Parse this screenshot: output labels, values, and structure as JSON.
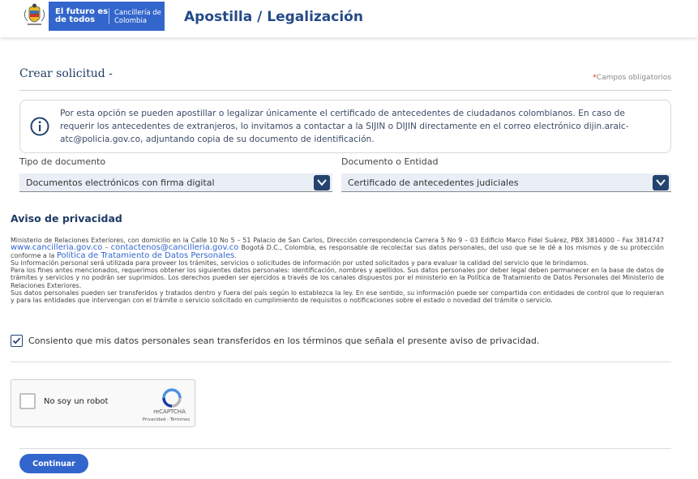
{
  "header": {
    "logo_line1": "El futuro es de todos",
    "logo_line2": "Cancillería de Colombia",
    "title": "Apostilla / Legalización"
  },
  "form": {
    "title": "Crear solicitud -",
    "required_star": "*",
    "required_note": "Campos obligatorios"
  },
  "info": {
    "text_before": "Por esta opción se pueden apostillar o legalizar únicamente el certificado de antecedentes de ciudadanos colombianos. En caso de requerir los antecedentes de extranjeros, lo invitamos a contactar a la SIJIN o DIJIN directamente en el correo electrónico ",
    "email": "dijin.araic-atc@policia.gov.co",
    "text_after": ", adjuntando copia de su documento de identificación."
  },
  "fields": {
    "tipo_label": "Tipo de documento",
    "tipo_value": "Documentos electrónicos con firma digital",
    "entidad_label": "Documento o Entidad",
    "entidad_value": "Certificado de antecedentes judiciales"
  },
  "privacy": {
    "title": "Aviso de privacidad",
    "p1_a": "Ministerio de Relaciones Exteriores, con domicilio en la Calle 10 No 5 – 51 Palacio de San Carlos, Dirección correspondencia Carrera 5 No 9 – 03 Edificio Marco Fidel Suárez, PBX 3814000 – Fax 3814747 ",
    "site_link": "www.cancilleria.gov.co",
    "p1_dash": " – ",
    "email_link": "contactenos@cancilleria.gov.co",
    "p1_b": " Bogotá D.C., Colombia, es responsable de recolectar sus datos personales, del uso que se le dé a los mismos y de su protección conforme a la ",
    "policy_link": "Política de Tratamiento de Datos Personales",
    "p1_end": ".",
    "p2": "Su información personal será utilizada para proveer los trámites, servicios o solicitudes de información por usted solicitados y para evaluar la calidad del servicio que le brindamos.",
    "p3": "Para los fines antes mencionados, requerimos obtener los siguientes datos personales: identificación, nombres y apellidos. Sus datos personales por deber legal deben permanecer en la base de datos de trámites y servicios y no podrán ser suprimidos. Los derechos pueden ser ejercidos a través de los canales dispuestos por el ministerio en la Política de Tratamiento de Datos Personales del Ministerio de Relaciones Exteriores.",
    "p4": "Sus datos personales pueden ser transferidos y tratados dentro y fuera del país según lo establezca la ley. En ese sentido, su información puede ser compartida con entidades de control que lo requieran y para las entidades que intervengan con el trámite o servicio solicitado en cumplimiento de requisitos o notificaciones sobre el estado o novedad del trámite o servicio.",
    "consent_label": "Consiento que mis datos personales sean transferidos en los términos que señala el presente aviso de privacidad.",
    "consent_checked": true
  },
  "recaptcha": {
    "label": "No soy un robot",
    "brand": "reCAPTCHA",
    "links": "Privacidad - Términos"
  },
  "actions": {
    "continue_label": "Continuar"
  },
  "colors": {
    "brand_blue": "#3366cc",
    "navy": "#24436e"
  }
}
